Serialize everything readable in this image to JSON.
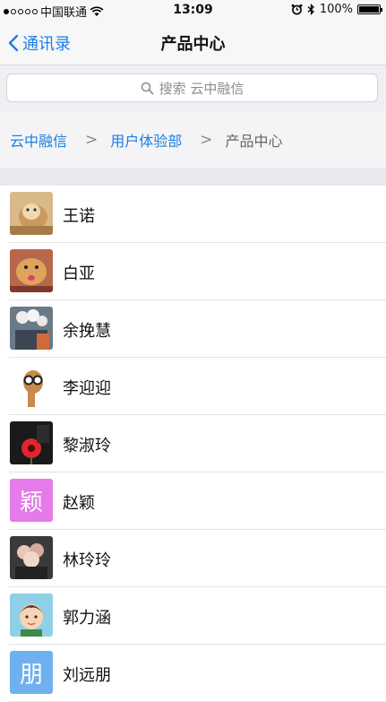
{
  "status_bar": {
    "carrier": "中国联通",
    "time": "13:09",
    "battery_percent": "100%"
  },
  "nav": {
    "back_label": "通讯录",
    "title": "产品中心"
  },
  "search": {
    "placeholder": "搜索 云中融信"
  },
  "breadcrumb": {
    "items": [
      "云中融信",
      "用户体验部",
      "产品中心"
    ]
  },
  "contacts": [
    {
      "name": "王诺",
      "avatar": "photo-cat"
    },
    {
      "name": "白亚",
      "avatar": "photo-cat-tongue"
    },
    {
      "name": "余挽慧",
      "avatar": "photo-flowers"
    },
    {
      "name": "李迎迎",
      "avatar": "photo-giraffe-glasses"
    },
    {
      "name": "黎淑玲",
      "avatar": "photo-red-flower"
    },
    {
      "name": "赵颖",
      "avatar": "letter",
      "avatar_text": "颖",
      "avatar_color": "#e57ae8"
    },
    {
      "name": "林玲玲",
      "avatar": "photo-bouquet"
    },
    {
      "name": "郭力涵",
      "avatar": "photo-cartoon-boy"
    },
    {
      "name": "刘远朋",
      "avatar": "letter",
      "avatar_text": "朋",
      "avatar_color": "#6fb0f0"
    }
  ],
  "colors": {
    "accent": "#1a7fe4",
    "background": "#efeff4"
  }
}
